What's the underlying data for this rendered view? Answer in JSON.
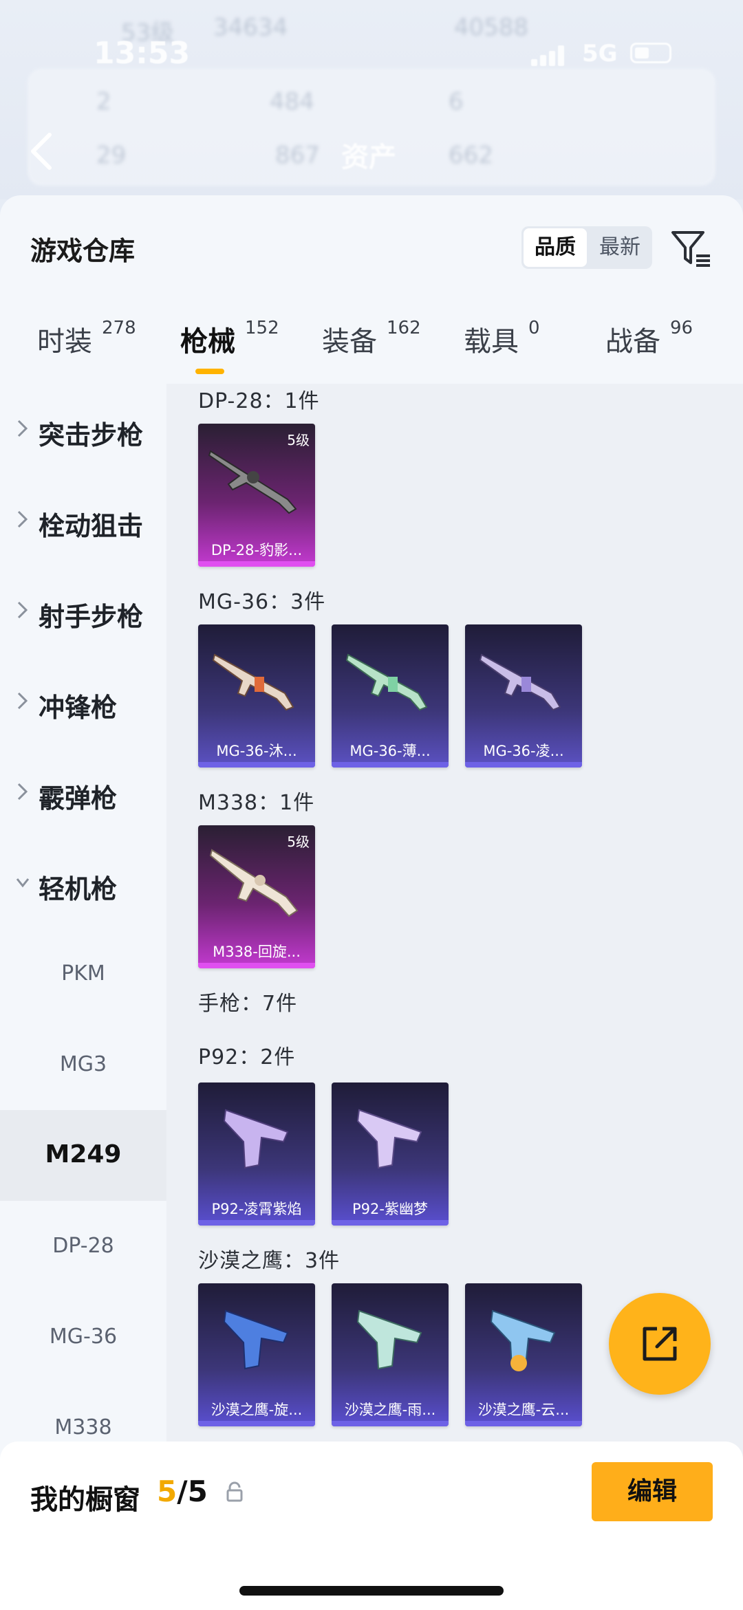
{
  "status_bar": {
    "time": "13:53",
    "network": "5G"
  },
  "background_header": {
    "title": "资产",
    "stats": [
      "53级",
      "34634",
      "40588",
      "2",
      "484",
      "6",
      "29",
      "867",
      "662"
    ]
  },
  "warehouse": {
    "title": "游戏仓库",
    "sort": {
      "options": [
        "品质",
        "最新"
      ],
      "selected": "品质"
    }
  },
  "tabs": [
    {
      "label": "时装",
      "count": "278"
    },
    {
      "label": "枪械",
      "count": "152",
      "active": true
    },
    {
      "label": "装备",
      "count": "162"
    },
    {
      "label": "载具",
      "count": "0"
    },
    {
      "label": "战备",
      "count": "96"
    }
  ],
  "categories": [
    {
      "label": "突击步枪",
      "expanded": false
    },
    {
      "label": "栓动狙击",
      "expanded": false
    },
    {
      "label": "射手步枪",
      "expanded": false
    },
    {
      "label": "冲锋枪",
      "expanded": false
    },
    {
      "label": "霰弹枪",
      "expanded": false
    },
    {
      "label": "轻机枪",
      "expanded": true
    }
  ],
  "subcategories": [
    "PKM",
    "MG3",
    "M249",
    "DP-28",
    "MG-36",
    "M338"
  ],
  "selected_subcategory": "M249",
  "groups": [
    {
      "title": "DP-28：1件",
      "items": [
        {
          "name": "DP-28-豹影...",
          "level": "5级",
          "rarity": "gold"
        }
      ]
    },
    {
      "title": "MG-36：3件",
      "items": [
        {
          "name": "MG-36-沐...",
          "rarity": "purple"
        },
        {
          "name": "MG-36-薄...",
          "rarity": "purple"
        },
        {
          "name": "MG-36-凌...",
          "rarity": "purple"
        }
      ]
    },
    {
      "title": "M338：1件",
      "items": [
        {
          "name": "M338-回旋...",
          "level": "5级",
          "rarity": "gold"
        }
      ]
    },
    {
      "title": "手枪：7件",
      "items": []
    },
    {
      "title": "P92：2件",
      "items": [
        {
          "name": "P92-凌霄紫焰",
          "rarity": "violet"
        },
        {
          "name": "P92-紫幽梦",
          "rarity": "violet"
        }
      ]
    },
    {
      "title": "沙漠之鹰：3件",
      "items": [
        {
          "name": "沙漠之鹰-旋...",
          "rarity": "violet"
        },
        {
          "name": "沙漠之鹰-雨...",
          "rarity": "violet"
        },
        {
          "name": "沙漠之鹰-云...",
          "rarity": "violet"
        }
      ]
    }
  ],
  "showcase": {
    "label": "我的橱窗",
    "current": "5",
    "total": "/5",
    "edit_label": "编辑"
  },
  "colors": {
    "accent": "#ffb31a",
    "gold_rarity": "#c43ad1",
    "purple_rarity": "#5c52c4"
  },
  "icons": [
    "back-icon",
    "filter-icon",
    "chevron-right-icon",
    "chevron-down-icon",
    "share-icon",
    "lock-icon"
  ]
}
